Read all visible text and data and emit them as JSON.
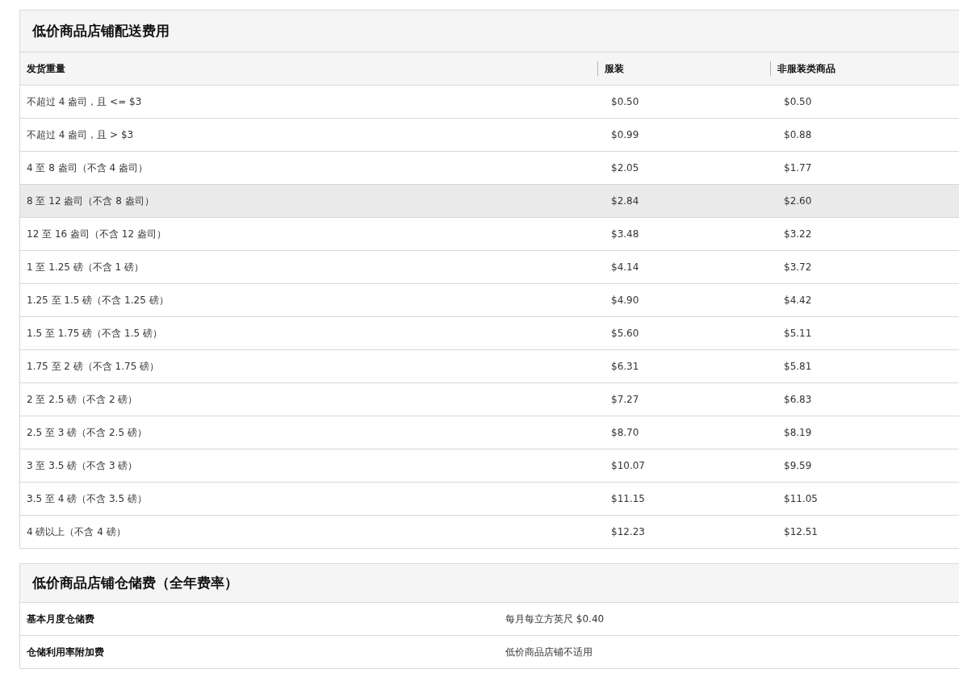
{
  "shipping_table": {
    "title": "低价商品店铺配送费用",
    "columns": [
      "发货重量",
      "服装",
      "非服装类商品"
    ],
    "rows": [
      {
        "cells": [
          "不超过 4 盎司，且 <= $3",
          "$0.50",
          "$0.50"
        ],
        "highlighted": false
      },
      {
        "cells": [
          "不超过 4 盎司，且 > $3",
          "$0.99",
          "$0.88"
        ],
        "highlighted": false
      },
      {
        "cells": [
          "4 至 8 盎司（不含 4 盎司）",
          "$2.05",
          "$1.77"
        ],
        "highlighted": false
      },
      {
        "cells": [
          "8 至 12 盎司（不含 8 盎司）",
          "$2.84",
          "$2.60"
        ],
        "highlighted": true
      },
      {
        "cells": [
          "12 至 16 盎司（不含 12 盎司）",
          "$3.48",
          "$3.22"
        ],
        "highlighted": false
      },
      {
        "cells": [
          "1 至 1.25 磅（不含 1 磅）",
          "$4.14",
          "$3.72"
        ],
        "highlighted": false
      },
      {
        "cells": [
          "1.25 至 1.5 磅（不含 1.25 磅）",
          "$4.90",
          "$4.42"
        ],
        "highlighted": false
      },
      {
        "cells": [
          "1.5 至 1.75 磅（不含 1.5 磅）",
          "$5.60",
          "$5.11"
        ],
        "highlighted": false
      },
      {
        "cells": [
          "1.75 至 2 磅（不含 1.75 磅）",
          "$6.31",
          "$5.81"
        ],
        "highlighted": false
      },
      {
        "cells": [
          "2 至 2.5 磅（不含 2 磅）",
          "$7.27",
          "$6.83"
        ],
        "highlighted": false
      },
      {
        "cells": [
          "2.5 至 3 磅（不含 2.5 磅）",
          "$8.70",
          "$8.19"
        ],
        "highlighted": false
      },
      {
        "cells": [
          "3 至 3.5 磅（不含 3 磅）",
          "$10.07",
          "$9.59"
        ],
        "highlighted": false
      },
      {
        "cells": [
          "3.5 至 4 磅（不含 3.5 磅）",
          "$11.15",
          "$11.05"
        ],
        "highlighted": false
      },
      {
        "cells": [
          "4 磅以上（不含 4 磅）",
          "$12.23",
          "$12.51"
        ],
        "highlighted": false
      }
    ]
  },
  "storage_table": {
    "title": "低价商品店铺仓储费（全年费率）",
    "rows": [
      {
        "label": "基本月度仓储费",
        "value": "每月每立方英尺 $0.40"
      },
      {
        "label": "仓储利用率附加费",
        "value": "低价商品店铺不适用"
      }
    ]
  }
}
